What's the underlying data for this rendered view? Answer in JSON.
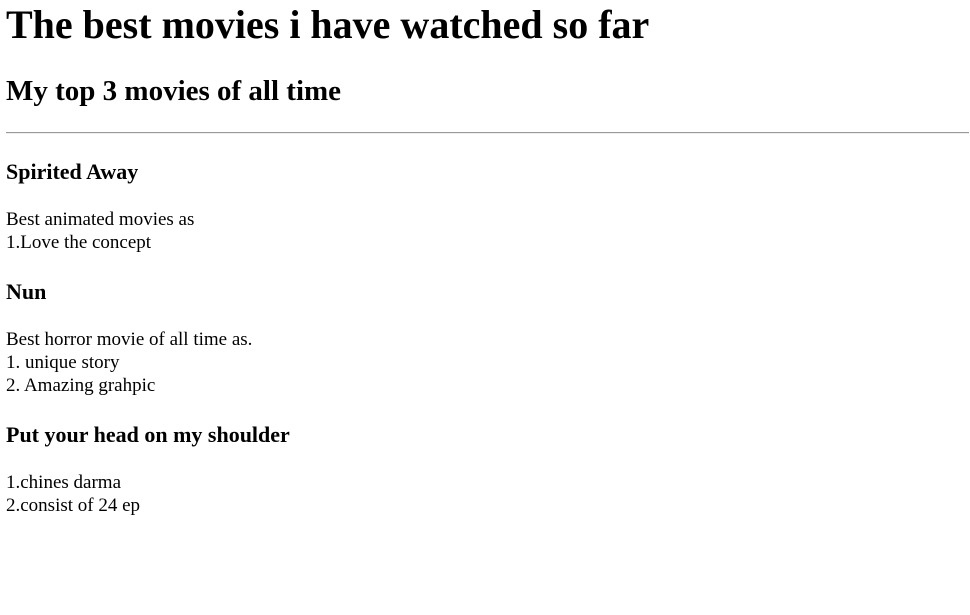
{
  "header": {
    "title": "The best movies i have watched so far",
    "subtitle": "My top 3 movies of all time"
  },
  "movies": [
    {
      "title": "Spirited Away",
      "lines": [
        "Best animated movies as",
        "1.Love the concept"
      ]
    },
    {
      "title": "Nun",
      "lines": [
        "Best horror movie of all time as.",
        "1. unique story",
        "2. Amazing grahpic"
      ]
    },
    {
      "title": "Put your head on my shoulder",
      "lines": [
        "1.chines darma",
        "2.consist of 24 ep"
      ]
    }
  ]
}
